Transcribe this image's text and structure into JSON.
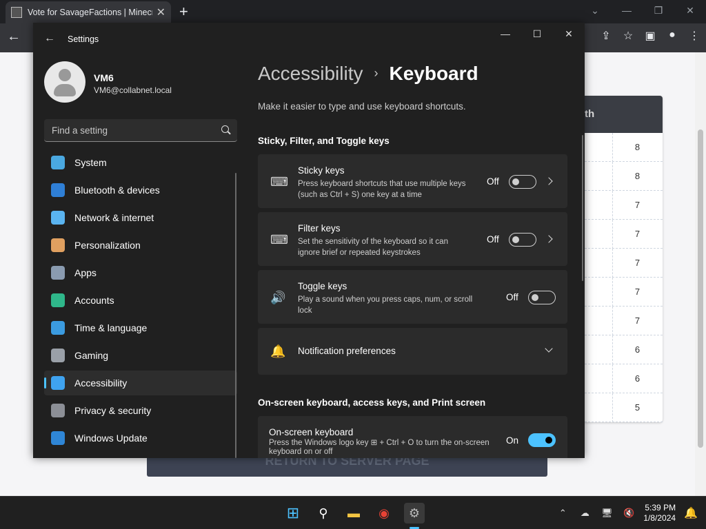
{
  "browser": {
    "tab_title": "Vote for SavageFactions | Minecr",
    "new_tab_label": "+",
    "close_label": "✕",
    "min_label": "—",
    "restore_label": "❐",
    "close_win_label": "✕"
  },
  "webpage": {
    "table_header": "th",
    "table_values": [
      "8",
      "8",
      "7",
      "7",
      "7",
      "7",
      "7",
      "6",
      "6",
      "5"
    ],
    "return_button": "RETURN TO SERVER PAGE"
  },
  "settings": {
    "window_title": "Settings",
    "profile": {
      "name": "VM6",
      "email": "VM6@collabnet.local"
    },
    "search_placeholder": "Find a setting",
    "nav": [
      {
        "label": "System",
        "icon": "system-icon",
        "color": "#4aa8e0"
      },
      {
        "label": "Bluetooth & devices",
        "icon": "bluetooth-icon",
        "color": "#2f7fd6"
      },
      {
        "label": "Network & internet",
        "icon": "wifi-icon",
        "color": "#5ab4f0"
      },
      {
        "label": "Personalization",
        "icon": "brush-icon",
        "color": "#e0a060"
      },
      {
        "label": "Apps",
        "icon": "apps-icon",
        "color": "#8a9bb0"
      },
      {
        "label": "Accounts",
        "icon": "accounts-icon",
        "color": "#2fb78a"
      },
      {
        "label": "Time & language",
        "icon": "globe-clock-icon",
        "color": "#3b9be0"
      },
      {
        "label": "Gaming",
        "icon": "gamepad-icon",
        "color": "#9aa0a8"
      },
      {
        "label": "Accessibility",
        "icon": "accessibility-icon",
        "color": "#3fa3f0"
      },
      {
        "label": "Privacy & security",
        "icon": "shield-icon",
        "color": "#8c8f96"
      },
      {
        "label": "Windows Update",
        "icon": "update-icon",
        "color": "#2f86d6"
      }
    ],
    "breadcrumb": {
      "parent": "Accessibility",
      "separator": "›",
      "current": "Keyboard"
    },
    "subtitle": "Make it easier to type and use keyboard shortcuts.",
    "section1": "Sticky, Filter, and Toggle keys",
    "cards": [
      {
        "title": "Sticky keys",
        "desc": "Press keyboard shortcuts that use multiple keys (such as Ctrl + S) one key at a time",
        "state": "Off",
        "icon": "⌨"
      },
      {
        "title": "Filter keys",
        "desc": "Set the sensitivity of the keyboard so it can ignore brief or repeated keystrokes",
        "state": "Off",
        "icon": "⌨"
      },
      {
        "title": "Toggle keys",
        "desc": "Play a sound when you press caps, num, or scroll lock",
        "state": "Off",
        "icon": "🔊"
      }
    ],
    "notification_prefs": "Notification preferences",
    "section2": "On-screen keyboard, access keys, and Print screen",
    "osk": {
      "title": "On-screen keyboard",
      "desc": "Press the Windows logo key ⊞ + Ctrl + O to turn the on-screen keyboard on or off",
      "state": "On"
    }
  },
  "taskbar": {
    "time": "5:39 PM",
    "date": "1/8/2024"
  }
}
